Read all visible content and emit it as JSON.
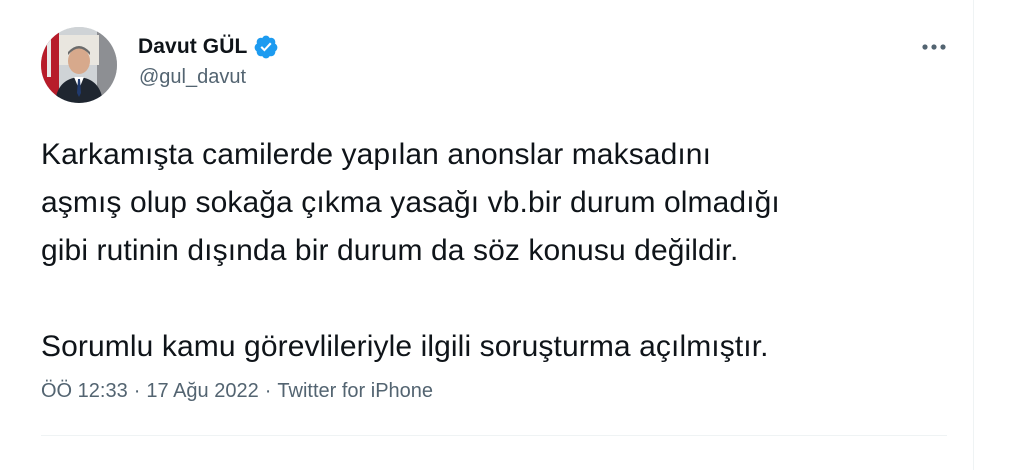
{
  "author": {
    "name": "Davut GÜL",
    "handle": "@gul_davut",
    "verified": true,
    "avatar_icon": "person-portrait-avatar"
  },
  "menu": {
    "icon": "more-horizontal-icon"
  },
  "tweet": {
    "paragraphs": [
      "Karkamışta camilerde yapılan anonslar maksadını\naşmış olup sokağa çıkma yasağı vb.bir durum olmadığı\ngibi rutinin dışında bir durum da söz konusu değildir.",
      "Sorumlu kamu görevlileriyle ilgili soruşturma açılmıştır."
    ]
  },
  "meta": {
    "time": "ÖÖ 12:33",
    "separator": "·",
    "date": "17 Ağu 2022",
    "source": "Twitter for iPhone"
  },
  "colors": {
    "text": "#0f1419",
    "secondary": "#536471",
    "verified": "#1d9bf0",
    "divider": "#eff3f4"
  }
}
